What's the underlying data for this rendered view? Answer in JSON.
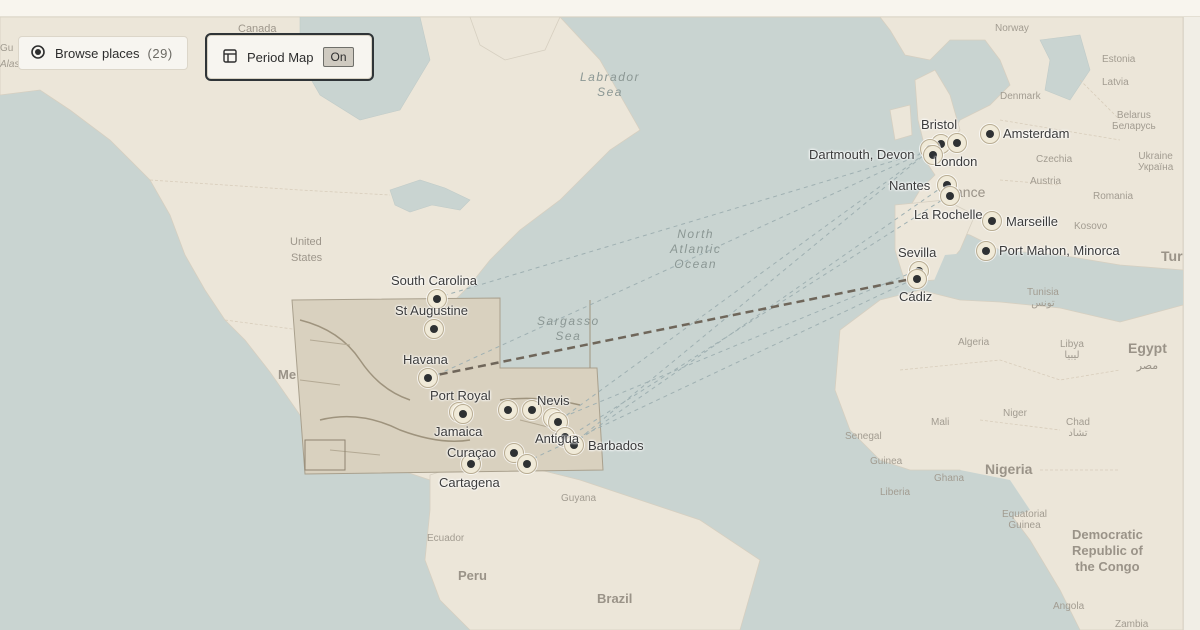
{
  "controls": {
    "browse_label": "Browse places",
    "browse_count": "(29)",
    "period_label": "Period Map",
    "period_toggle": "On"
  },
  "base_labels": {
    "canada": "Canada",
    "us_line1": "United",
    "us_line2": "States",
    "labrador_sea_1": "Labrador",
    "labrador_sea_2": "Sea",
    "north_atlantic_1": "North",
    "north_atlantic_2": "Atlantic",
    "north_atlantic_3": "Ocean",
    "sargasso_1": "Sargasso",
    "sargasso_2": "Sea",
    "norway": "Norway",
    "estonia": "Estonia",
    "latvia": "Latvia",
    "denmark": "Denmark",
    "belarus_1": "Belarus",
    "belarus_2": "Беларусь",
    "ukraine_1": "Ukraine",
    "ukraine_2": "Україна",
    "czechia": "Czechia",
    "austria": "Austria",
    "romania": "Romania",
    "kosovo": "Kosovo",
    "france_frag": "ance",
    "tunisia_1": "Tunisia",
    "tunisia_2": "تونس",
    "algeria": "Algeria",
    "libya_1": "Libya",
    "libya_2": "ليبيا",
    "egypt_1": "Egypt",
    "egypt_2": "مصر",
    "tur_frag": "Tur",
    "mali": "Mali",
    "niger": "Niger",
    "chad_1": "Chad",
    "chad_2": "تشاد",
    "senegal": "Senegal",
    "guinea": "Guinea",
    "ghana": "Ghana",
    "liberia": "Liberia",
    "nigeria": "Nigeria",
    "eq_guinea_1": "Equatorial",
    "eq_guinea_2": "Guinea",
    "drc_1": "Democratic",
    "drc_2": "Republic of",
    "drc_3": "the Congo",
    "angola": "Angola",
    "zambia": "Zambia",
    "guyana": "Guyana",
    "ecuador": "Ecuador",
    "peru": "Peru",
    "brazil": "Brazil",
    "mexico_frag": "Me",
    "gulf_frag_1": "Gu",
    "gulf_frag_2": "Alas"
  },
  "places": [
    {
      "name": "South Carolina"
    },
    {
      "name": "St Augustine"
    },
    {
      "name": "Havana"
    },
    {
      "name": "Port Royal"
    },
    {
      "name": "Jamaica"
    },
    {
      "name": "Nevis"
    },
    {
      "name": "Antigua"
    },
    {
      "name": "Barbados"
    },
    {
      "name": "Curaçao"
    },
    {
      "name": "Cartagena"
    },
    {
      "name": "Bristol"
    },
    {
      "name": "Dartmouth, Devon"
    },
    {
      "name": "London"
    },
    {
      "name": "Amsterdam"
    },
    {
      "name": "Nantes"
    },
    {
      "name": "La Rochelle"
    },
    {
      "name": "Marseille"
    },
    {
      "name": "Port Mahon, Minorca"
    },
    {
      "name": "Sevilla"
    },
    {
      "name": "Cádiz"
    }
  ]
}
